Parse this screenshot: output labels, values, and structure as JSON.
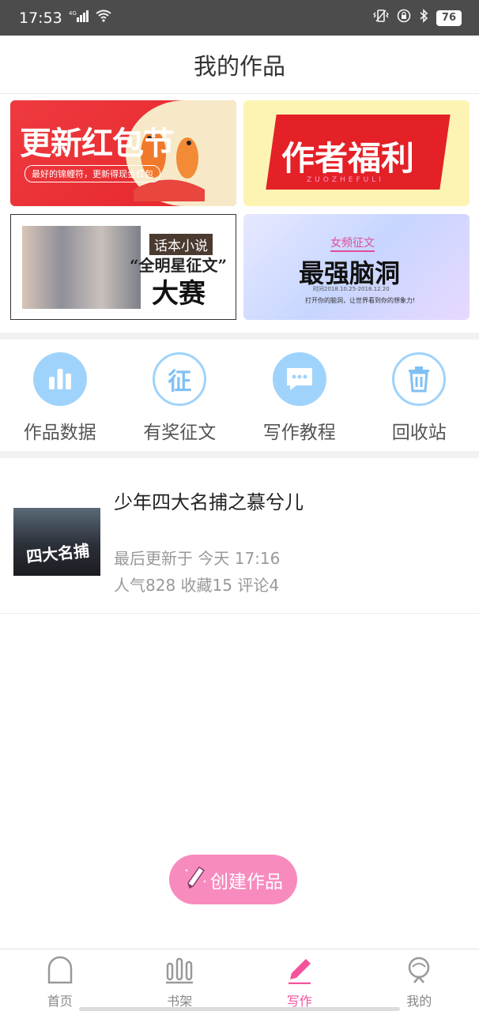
{
  "status_bar": {
    "time": "17:53",
    "network": "4G",
    "battery": "76"
  },
  "header": {
    "title": "我的作品"
  },
  "banners": [
    {
      "title": "更新红包节",
      "subtitle": "最好的锦鲤符，更新得现金红包"
    },
    {
      "title": "作者福利",
      "subtitle": "ZUOZHEFULI"
    },
    {
      "tag": "话本小说",
      "title": "“全明星征文”",
      "title2": "大赛"
    },
    {
      "tag": "女频征文",
      "title": "最强脑洞",
      "dates": "时间2018.10.25-2018.12.20",
      "subtitle": "打开你的脑洞，让世界看到你的想象力!"
    }
  ],
  "quick_actions": [
    {
      "label": "作品数据",
      "icon": "bar-chart-icon"
    },
    {
      "label": "有奖征文",
      "icon": "zheng-icon",
      "glyph": "征"
    },
    {
      "label": "写作教程",
      "icon": "chat-bubble-icon"
    },
    {
      "label": "回收站",
      "icon": "trash-icon"
    }
  ],
  "work": {
    "title": "少年四大名捕之慕兮儿",
    "cover_text": "四大名捕",
    "updated": "最后更新于 今天 17:16",
    "stats": "人气828 收藏15 评论4"
  },
  "create_button": {
    "label": "创建作品"
  },
  "tabbar": [
    {
      "label": "首页",
      "icon": "home-icon"
    },
    {
      "label": "书架",
      "icon": "bookshelf-icon"
    },
    {
      "label": "写作",
      "icon": "pencil-icon",
      "active": true
    },
    {
      "label": "我的",
      "icon": "profile-icon"
    }
  ],
  "colors": {
    "accent": "#f2539b",
    "icon_blue": "#9fd3fb",
    "button_pink": "#f78bbe"
  }
}
